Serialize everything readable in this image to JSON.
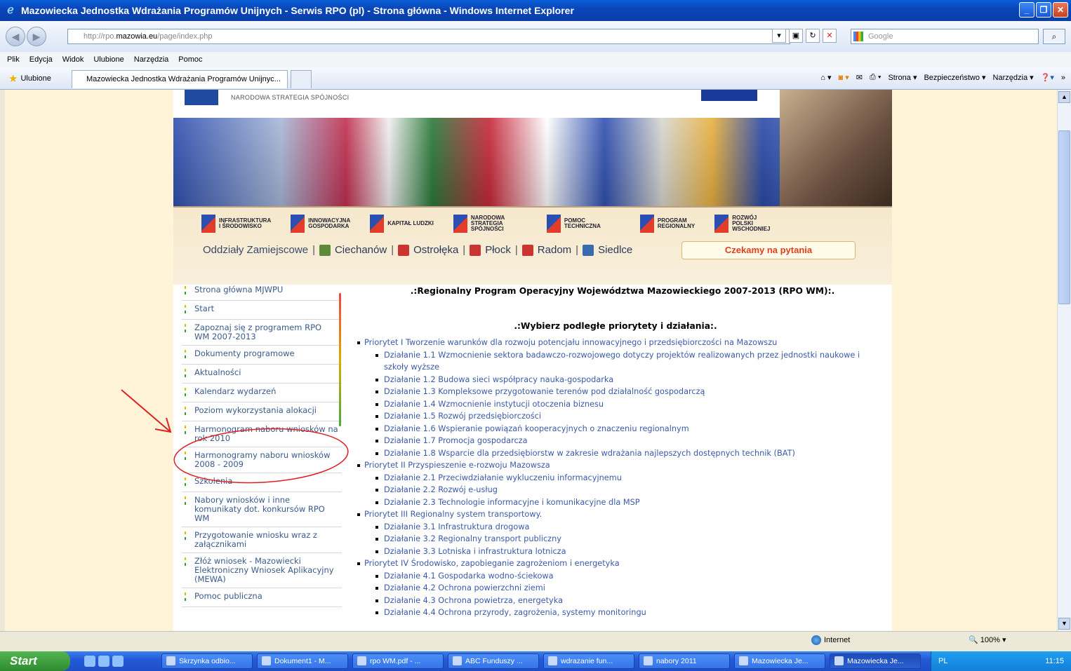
{
  "window": {
    "title": "Mazowiecka Jednostka Wdrażania Programów Unijnych - Serwis RPO (pl) - Strona główna - Windows Internet Explorer"
  },
  "address": {
    "prefix": "http://rpo.",
    "domain": "mazowia.eu",
    "path": "/page/index.php"
  },
  "search": {
    "placeholder": "Google"
  },
  "menu": [
    "Plik",
    "Edycja",
    "Widok",
    "Ulubione",
    "Narzędzia",
    "Pomoc"
  ],
  "favorites": {
    "label": "Ulubione",
    "tab_title": "Mazowiecka Jednostka Wdrażania Programów Unijnyc..."
  },
  "commandbar": {
    "page": "Strona",
    "security": "Bezpieczeństwo",
    "tools": "Narzędzia"
  },
  "header": {
    "nss": "NARODOWA STRATEGIA SPÓJNOŚCI",
    "programs": [
      [
        "INFRASTRUKTURA",
        "I ŚRODOWISKO"
      ],
      [
        "INNOWACYJNA",
        "GOSPODARKA"
      ],
      [
        "KAPITAŁ LUDZKI",
        ""
      ],
      [
        "NARODOWA",
        "STRATEGIA SPÓJNOŚCI"
      ],
      [
        "POMOC TECHNICZNA",
        ""
      ],
      [
        "PROGRAM",
        "REGIONALNY"
      ],
      [
        "ROZWÓJ",
        "POLSKI WSCHODNIEJ"
      ]
    ],
    "branches_label": "Oddziały Zamiejscowe",
    "branches": [
      "Ciechanów",
      "Ostrołęka",
      "Płock",
      "Radom",
      "Siedlce"
    ],
    "questions": "Czekamy na pytania"
  },
  "sidebar": [
    "Strona główna MJWPU",
    "Start",
    "Zapoznaj się z programem RPO WM 2007-2013",
    "Dokumenty programowe",
    "Aktualności",
    "Kalendarz wydarzeń",
    "Poziom wykorzystania alokacji",
    "Harmonogram naboru wniosków na rok 2010",
    "Harmonogramy naboru wniosków 2008 - 2009",
    "Szkolenia",
    "Nabory wniosków i inne komunikaty dot. konkursów RPO WM",
    "Przygotowanie wniosku wraz z załącznikami",
    "Złóż wniosek - Mazowiecki Elektroniczny Wniosek Aplikacyjny (MEWA)",
    "Pomoc publiczna"
  ],
  "main": {
    "title": ".:Regionalny Program Operacyjny Województwa Mazowieckiego 2007-2013 (RPO WM):.",
    "subtitle": ".:Wybierz podległe priorytety i działania:.",
    "priorities": [
      {
        "label": "Priorytet I Tworzenie warunków dla rozwoju potencjału innowacyjnego i przedsiębiorczości na Mazowszu",
        "items": [
          "Działanie 1.1 Wzmocnienie sektora badawczo-rozwojowego dotyczy projektów realizowanych przez jednostki naukowe i szkoły wyższe",
          "Działanie 1.2 Budowa sieci współpracy nauka-gospodarka",
          "Działanie 1.3 Kompleksowe przygotowanie terenów pod działalność gospodarczą",
          "Działanie 1.4 Wzmocnienie instytucji otoczenia biznesu",
          "Działanie 1.5 Rozwój przedsiębiorczości",
          "Działanie 1.6 Wspieranie powiązań kooperacyjnych o znaczeniu regionalnym",
          "Działanie 1.7 Promocja gospodarcza",
          "Działanie 1.8 Wsparcie dla przedsiębiorstw w zakresie wdrażania najlepszych dostępnych technik (BAT)"
        ]
      },
      {
        "label": "Priorytet II Przyspieszenie e-rozwoju Mazowsza",
        "items": [
          "Działanie 2.1 Przeciwdziałanie wykluczeniu informacyjnemu",
          "Działanie 2.2 Rozwój e-usług",
          "Działanie 2.3 Technologie informacyjne i komunikacyjne dla MSP"
        ]
      },
      {
        "label": "Priorytet III Regionalny system transportowy.",
        "items": [
          "Działanie 3.1 Infrastruktura drogowa",
          "Działanie 3.2 Regionalny transport publiczny",
          "Działanie 3.3 Lotniska i infrastruktura lotnicza"
        ]
      },
      {
        "label": "Priorytet IV Środowisko, zapobieganie zagrożeniom i energetyka",
        "items": [
          "Działanie 4.1 Gospodarka wodno-ściekowa",
          "Działanie 4.2 Ochrona powierzchni ziemi",
          "Działanie 4.3 Ochrona powietrza, energetyka",
          "Działanie 4.4 Ochrona przyrody, zagrożenia, systemy monitoringu"
        ]
      }
    ]
  },
  "status": {
    "zone": "Internet",
    "zoom": "100%"
  },
  "taskbar": {
    "start": "Start",
    "buttons": [
      "Skrzynka odbio...",
      "Dokument1 - M...",
      "rpo WM.pdf - ...",
      "ABC Funduszy ...",
      "wdrazanie fun...",
      "nabory 2011",
      "Mazowiecka Je...",
      "Mazowiecka Je..."
    ],
    "lang": "PL",
    "clock": "11:15"
  },
  "colors": {
    "annotation": "#e02020",
    "link": "#3a5aa8"
  }
}
